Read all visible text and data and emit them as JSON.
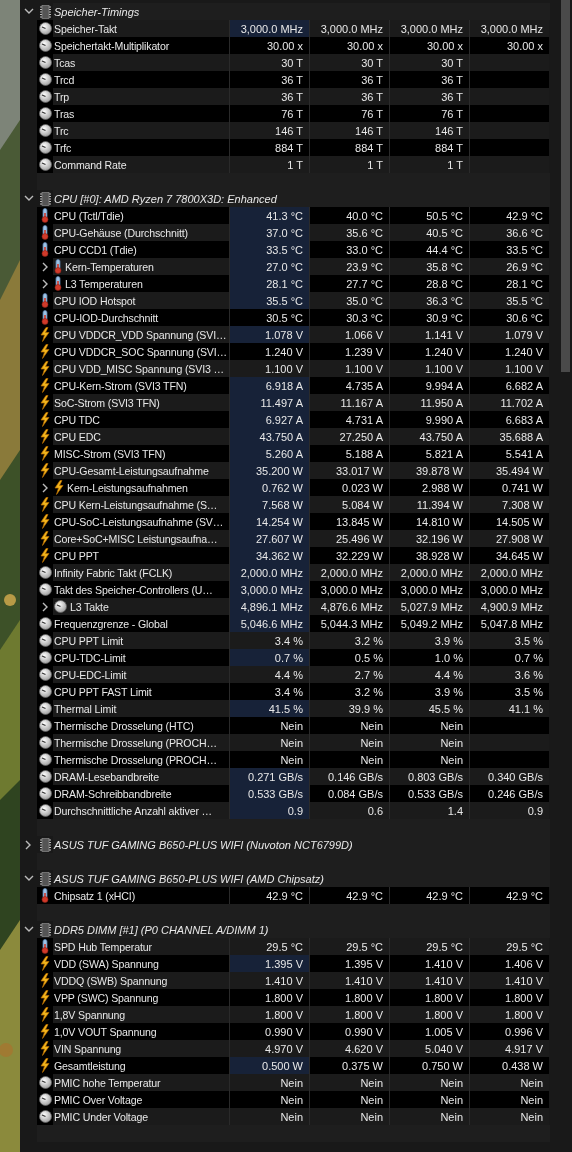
{
  "sensor_groups": [
    {
      "title": "Speicher-Timings",
      "expanded": true,
      "rows": [
        {
          "name": "Speicher-Takt",
          "kind": "clock",
          "highlighted": true,
          "values": [
            "3,000.0 MHz",
            "3,000.0 MHz",
            "3,000.0 MHz",
            "3,000.0 MHz"
          ]
        },
        {
          "name": "Speichertakt-Multiplikator",
          "kind": "clock",
          "highlighted": false,
          "values": [
            "30.00 x",
            "30.00 x",
            "30.00 x",
            "30.00 x"
          ]
        },
        {
          "name": "Tcas",
          "kind": "clock",
          "highlighted": false,
          "values": [
            "30 T",
            "30 T",
            "30 T"
          ]
        },
        {
          "name": "Trcd",
          "kind": "clock",
          "highlighted": false,
          "values": [
            "36 T",
            "36 T",
            "36 T"
          ]
        },
        {
          "name": "Trp",
          "kind": "clock",
          "highlighted": false,
          "values": [
            "36 T",
            "36 T",
            "36 T"
          ]
        },
        {
          "name": "Tras",
          "kind": "clock",
          "highlighted": false,
          "values": [
            "76 T",
            "76 T",
            "76 T"
          ]
        },
        {
          "name": "Trc",
          "kind": "clock",
          "highlighted": false,
          "values": [
            "146 T",
            "146 T",
            "146 T"
          ]
        },
        {
          "name": "Trfc",
          "kind": "clock",
          "highlighted": false,
          "values": [
            "884 T",
            "884 T",
            "884 T"
          ]
        },
        {
          "name": "Command Rate",
          "kind": "clock",
          "highlighted": false,
          "values": [
            "1 T",
            "1 T",
            "1 T"
          ]
        }
      ]
    },
    {
      "title": "CPU [#0]: AMD Ryzen 7 7800X3D: Enhanced",
      "expanded": true,
      "rows": [
        {
          "name": "CPU (Tctl/Tdie)",
          "kind": "temp",
          "highlighted": true,
          "values": [
            "41.3 °C",
            "40.0 °C",
            "50.5 °C",
            "42.9 °C"
          ]
        },
        {
          "name": "CPU-Gehäuse (Durchschnitt)",
          "kind": "temp",
          "highlighted": true,
          "values": [
            "37.0 °C",
            "35.6 °C",
            "40.5 °C",
            "36.6 °C"
          ]
        },
        {
          "name": "CPU CCD1 (Tdie)",
          "kind": "temp",
          "highlighted": true,
          "values": [
            "33.5 °C",
            "33.0 °C",
            "44.4 °C",
            "33.5 °C"
          ]
        },
        {
          "name": "Kern-Temperaturen",
          "kind": "temp",
          "expanded": false,
          "highlighted": true,
          "values": [
            "27.0 °C",
            "23.9 °C",
            "35.8 °C",
            "26.9 °C"
          ]
        },
        {
          "name": "L3 Temperaturen",
          "kind": "temp",
          "expanded": false,
          "highlighted": true,
          "values": [
            "28.1 °C",
            "27.7 °C",
            "28.8 °C",
            "28.1 °C"
          ]
        },
        {
          "name": "CPU IOD Hotspot",
          "kind": "temp",
          "highlighted": true,
          "values": [
            "35.5 °C",
            "35.0 °C",
            "36.3 °C",
            "35.5 °C"
          ]
        },
        {
          "name": "CPU-IOD-Durchschnitt",
          "kind": "temp",
          "highlighted": false,
          "values": [
            "30.5 °C",
            "30.3 °C",
            "30.9 °C",
            "30.6 °C"
          ]
        },
        {
          "name": "CPU VDDCR_VDD Spannung (SVI…",
          "kind": "power",
          "highlighted": true,
          "values": [
            "1.078 V",
            "1.066 V",
            "1.141 V",
            "1.079 V"
          ]
        },
        {
          "name": "CPU VDDCR_SOC Spannung (SVI…",
          "kind": "power",
          "highlighted": false,
          "values": [
            "1.240 V",
            "1.239 V",
            "1.240 V",
            "1.240 V"
          ]
        },
        {
          "name": "CPU VDD_MISC Spannung (SVI3 …",
          "kind": "power",
          "highlighted": false,
          "values": [
            "1.100 V",
            "1.100 V",
            "1.100 V",
            "1.100 V"
          ]
        },
        {
          "name": "CPU-Kern-Strom (SVI3 TFN)",
          "kind": "power",
          "highlighted": true,
          "values": [
            "6.918 A",
            "4.735 A",
            "9.994 A",
            "6.682 A"
          ]
        },
        {
          "name": "SoC-Strom (SVI3 TFN)",
          "kind": "power",
          "highlighted": true,
          "values": [
            "11.497 A",
            "11.167 A",
            "11.950 A",
            "11.702 A"
          ]
        },
        {
          "name": "CPU TDC",
          "kind": "power",
          "highlighted": true,
          "values": [
            "6.927 A",
            "4.731 A",
            "9.990 A",
            "6.683 A"
          ]
        },
        {
          "name": "CPU EDC",
          "kind": "power",
          "highlighted": true,
          "values": [
            "43.750 A",
            "27.250 A",
            "43.750 A",
            "35.688 A"
          ]
        },
        {
          "name": "MISC-Strom (SVI3 TFN)",
          "kind": "power",
          "highlighted": true,
          "values": [
            "5.260 A",
            "5.188 A",
            "5.821 A",
            "5.541 A"
          ]
        },
        {
          "name": "CPU-Gesamt-Leistungsaufnahme",
          "kind": "power",
          "highlighted": true,
          "values": [
            "35.200 W",
            "33.017 W",
            "39.878 W",
            "35.494 W"
          ]
        },
        {
          "name": "Kern-Leistungsaufnahmen",
          "kind": "power",
          "expanded": false,
          "highlighted": true,
          "values": [
            "0.762 W",
            "0.023 W",
            "2.988 W",
            "0.741 W"
          ]
        },
        {
          "name": "CPU Kern-Leistungsaufnahme (S…",
          "kind": "power",
          "highlighted": true,
          "values": [
            "7.568 W",
            "5.084 W",
            "11.394 W",
            "7.308 W"
          ]
        },
        {
          "name": "CPU-SoC-Leistungsaufnahme (SV…",
          "kind": "power",
          "highlighted": true,
          "values": [
            "14.254 W",
            "13.845 W",
            "14.810 W",
            "14.505 W"
          ]
        },
        {
          "name": "Core+SoC+MISC Leistungsaufna…",
          "kind": "power",
          "highlighted": true,
          "values": [
            "27.607 W",
            "25.496 W",
            "32.196 W",
            "27.908 W"
          ]
        },
        {
          "name": "CPU PPT",
          "kind": "power",
          "highlighted": true,
          "values": [
            "34.362 W",
            "32.229 W",
            "38.928 W",
            "34.645 W"
          ]
        },
        {
          "name": "Infinity Fabric Takt (FCLK)",
          "kind": "clock",
          "highlighted": true,
          "values": [
            "2,000.0 MHz",
            "2,000.0 MHz",
            "2,000.0 MHz",
            "2,000.0 MHz"
          ]
        },
        {
          "name": "Takt des Speicher-Controllers (U…",
          "kind": "clock",
          "highlighted": true,
          "values": [
            "3,000.0 MHz",
            "3,000.0 MHz",
            "3,000.0 MHz",
            "3,000.0 MHz"
          ]
        },
        {
          "name": "L3 Takte",
          "kind": "clock",
          "expanded": false,
          "highlighted": true,
          "values": [
            "4,896.1 MHz",
            "4,876.6 MHz",
            "5,027.9 MHz",
            "4,900.9 MHz"
          ]
        },
        {
          "name": "Frequenzgrenze - Global",
          "kind": "clock",
          "highlighted": true,
          "values": [
            "5,046.6 MHz",
            "5,044.3 MHz",
            "5,049.2 MHz",
            "5,047.8 MHz"
          ]
        },
        {
          "name": "CPU PPT Limit",
          "kind": "clock",
          "highlighted": false,
          "values": [
            "3.4 %",
            "3.2 %",
            "3.9 %",
            "3.5 %"
          ]
        },
        {
          "name": "CPU-TDC-Limit",
          "kind": "clock",
          "highlighted": true,
          "values": [
            "0.7 %",
            "0.5 %",
            "1.0 %",
            "0.7 %"
          ]
        },
        {
          "name": "CPU-EDC-Limit",
          "kind": "clock",
          "highlighted": false,
          "values": [
            "4.4 %",
            "2.7 %",
            "4.4 %",
            "3.6 %"
          ]
        },
        {
          "name": "CPU PPT FAST Limit",
          "kind": "clock",
          "highlighted": false,
          "values": [
            "3.4 %",
            "3.2 %",
            "3.9 %",
            "3.5 %"
          ]
        },
        {
          "name": "Thermal Limit",
          "kind": "clock",
          "highlighted": true,
          "values": [
            "41.5 %",
            "39.9 %",
            "45.5 %",
            "41.1 %"
          ]
        },
        {
          "name": "Thermische Drosselung (HTC)",
          "kind": "clock",
          "highlighted": false,
          "values": [
            "Nein",
            "Nein",
            "Nein"
          ]
        },
        {
          "name": "Thermische Drosselung (PROCH…",
          "kind": "clock",
          "highlighted": false,
          "values": [
            "Nein",
            "Nein",
            "Nein"
          ]
        },
        {
          "name": "Thermische Drosselung (PROCH…",
          "kind": "clock",
          "highlighted": false,
          "values": [
            "Nein",
            "Nein",
            "Nein"
          ]
        },
        {
          "name": "DRAM-Lesebandbreite",
          "kind": "clock",
          "highlighted": true,
          "values": [
            "0.271 GB/s",
            "0.146 GB/s",
            "0.803 GB/s",
            "0.340 GB/s"
          ]
        },
        {
          "name": "DRAM-Schreibbandbreite",
          "kind": "clock",
          "highlighted": true,
          "values": [
            "0.533 GB/s",
            "0.084 GB/s",
            "0.533 GB/s",
            "0.246 GB/s"
          ]
        },
        {
          "name": "Durchschnittliche Anzahl aktiver …",
          "kind": "clock",
          "highlighted": true,
          "values": [
            "0.9",
            "0.6",
            "1.4",
            "0.9"
          ]
        }
      ]
    },
    {
      "title": "ASUS TUF GAMING B650-PLUS WIFI (Nuvoton NCT6799D)",
      "expanded": false
    },
    {
      "title": "ASUS TUF GAMING B650-PLUS WIFI (AMD Chipsatz)",
      "expanded": true,
      "rows": [
        {
          "name": "Chipsatz 1 (xHCI)",
          "kind": "temp",
          "highlighted": false,
          "values": [
            "42.9 °C",
            "42.9 °C",
            "42.9 °C",
            "42.9 °C"
          ]
        }
      ]
    },
    {
      "title": "DDR5 DIMM [#1] (P0 CHANNEL A/DIMM 1)",
      "expanded": true,
      "rows": [
        {
          "name": "SPD Hub Temperatur",
          "kind": "temp",
          "highlighted": false,
          "values": [
            "29.5 °C",
            "29.5 °C",
            "29.5 °C",
            "29.5 °C"
          ]
        },
        {
          "name": "VDD (SWA) Spannung",
          "kind": "power",
          "highlighted": true,
          "values": [
            "1.395 V",
            "1.395 V",
            "1.410 V",
            "1.406 V"
          ]
        },
        {
          "name": "VDDQ (SWB) Spannung",
          "kind": "power",
          "highlighted": false,
          "values": [
            "1.410 V",
            "1.410 V",
            "1.410 V",
            "1.410 V"
          ]
        },
        {
          "name": "VPP (SWC) Spannung",
          "kind": "power",
          "highlighted": false,
          "values": [
            "1.800 V",
            "1.800 V",
            "1.800 V",
            "1.800 V"
          ]
        },
        {
          "name": "1,8V Spannung",
          "kind": "power",
          "highlighted": false,
          "values": [
            "1.800 V",
            "1.800 V",
            "1.800 V",
            "1.800 V"
          ]
        },
        {
          "name": "1,0V VOUT Spannung",
          "kind": "power",
          "highlighted": false,
          "values": [
            "0.990 V",
            "0.990 V",
            "1.005 V",
            "0.996 V"
          ]
        },
        {
          "name": "VIN Spannung",
          "kind": "power",
          "highlighted": false,
          "values": [
            "4.970 V",
            "4.620 V",
            "5.040 V",
            "4.917 V"
          ]
        },
        {
          "name": "Gesamtleistung",
          "kind": "power",
          "highlighted": true,
          "values": [
            "0.500 W",
            "0.375 W",
            "0.750 W",
            "0.438 W"
          ]
        },
        {
          "name": "PMIC hohe Temperatur",
          "kind": "clock",
          "highlighted": false,
          "values": [
            "Nein",
            "Nein",
            "Nein",
            "Nein"
          ]
        },
        {
          "name": "PMIC Over Voltage",
          "kind": "clock",
          "highlighted": false,
          "values": [
            "Nein",
            "Nein",
            "Nein",
            "Nein"
          ]
        },
        {
          "name": "PMIC Under Voltage",
          "kind": "clock",
          "highlighted": false,
          "values": [
            "Nein",
            "Nein",
            "Nein",
            "Nein"
          ]
        }
      ]
    }
  ]
}
